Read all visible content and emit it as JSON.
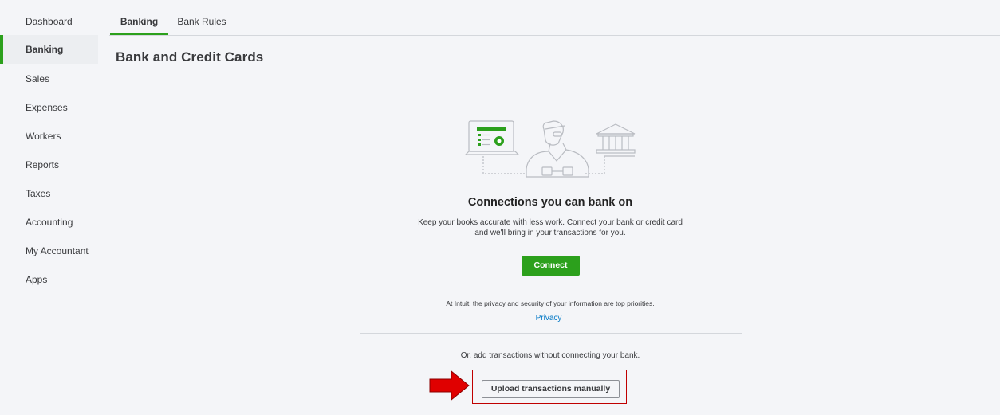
{
  "sidebar": {
    "items": [
      {
        "label": "Dashboard",
        "active": false
      },
      {
        "label": "Banking",
        "active": true
      },
      {
        "label": "Sales",
        "active": false
      },
      {
        "label": "Expenses",
        "active": false
      },
      {
        "label": "Workers",
        "active": false
      },
      {
        "label": "Reports",
        "active": false
      },
      {
        "label": "Taxes",
        "active": false
      },
      {
        "label": "Accounting",
        "active": false
      },
      {
        "label": "My Accountant",
        "active": false
      },
      {
        "label": "Apps",
        "active": false
      }
    ]
  },
  "tabs": [
    {
      "label": "Banking",
      "active": true
    },
    {
      "label": "Bank Rules",
      "active": false
    }
  ],
  "page": {
    "title": "Bank and Credit Cards"
  },
  "empty_state": {
    "illustration": "laptop-person-bank-icon",
    "headline": "Connections you can bank on",
    "description": "Keep your books accurate with less work. Connect your bank or credit card and we'll bring in your transactions for you.",
    "connect_label": "Connect",
    "privacy_note": "At Intuit, the privacy and security of your information are top priorities.",
    "privacy_link": "Privacy",
    "or_text": "Or, add transactions without connecting your bank.",
    "upload_label": "Upload transactions manually"
  },
  "annotation": {
    "arrow_icon": "red-arrow-icon",
    "highlight_color": "#c00000"
  },
  "colors": {
    "brand_green": "#2ca01c",
    "link_blue": "#0077c5",
    "background": "#f4f5f8"
  }
}
